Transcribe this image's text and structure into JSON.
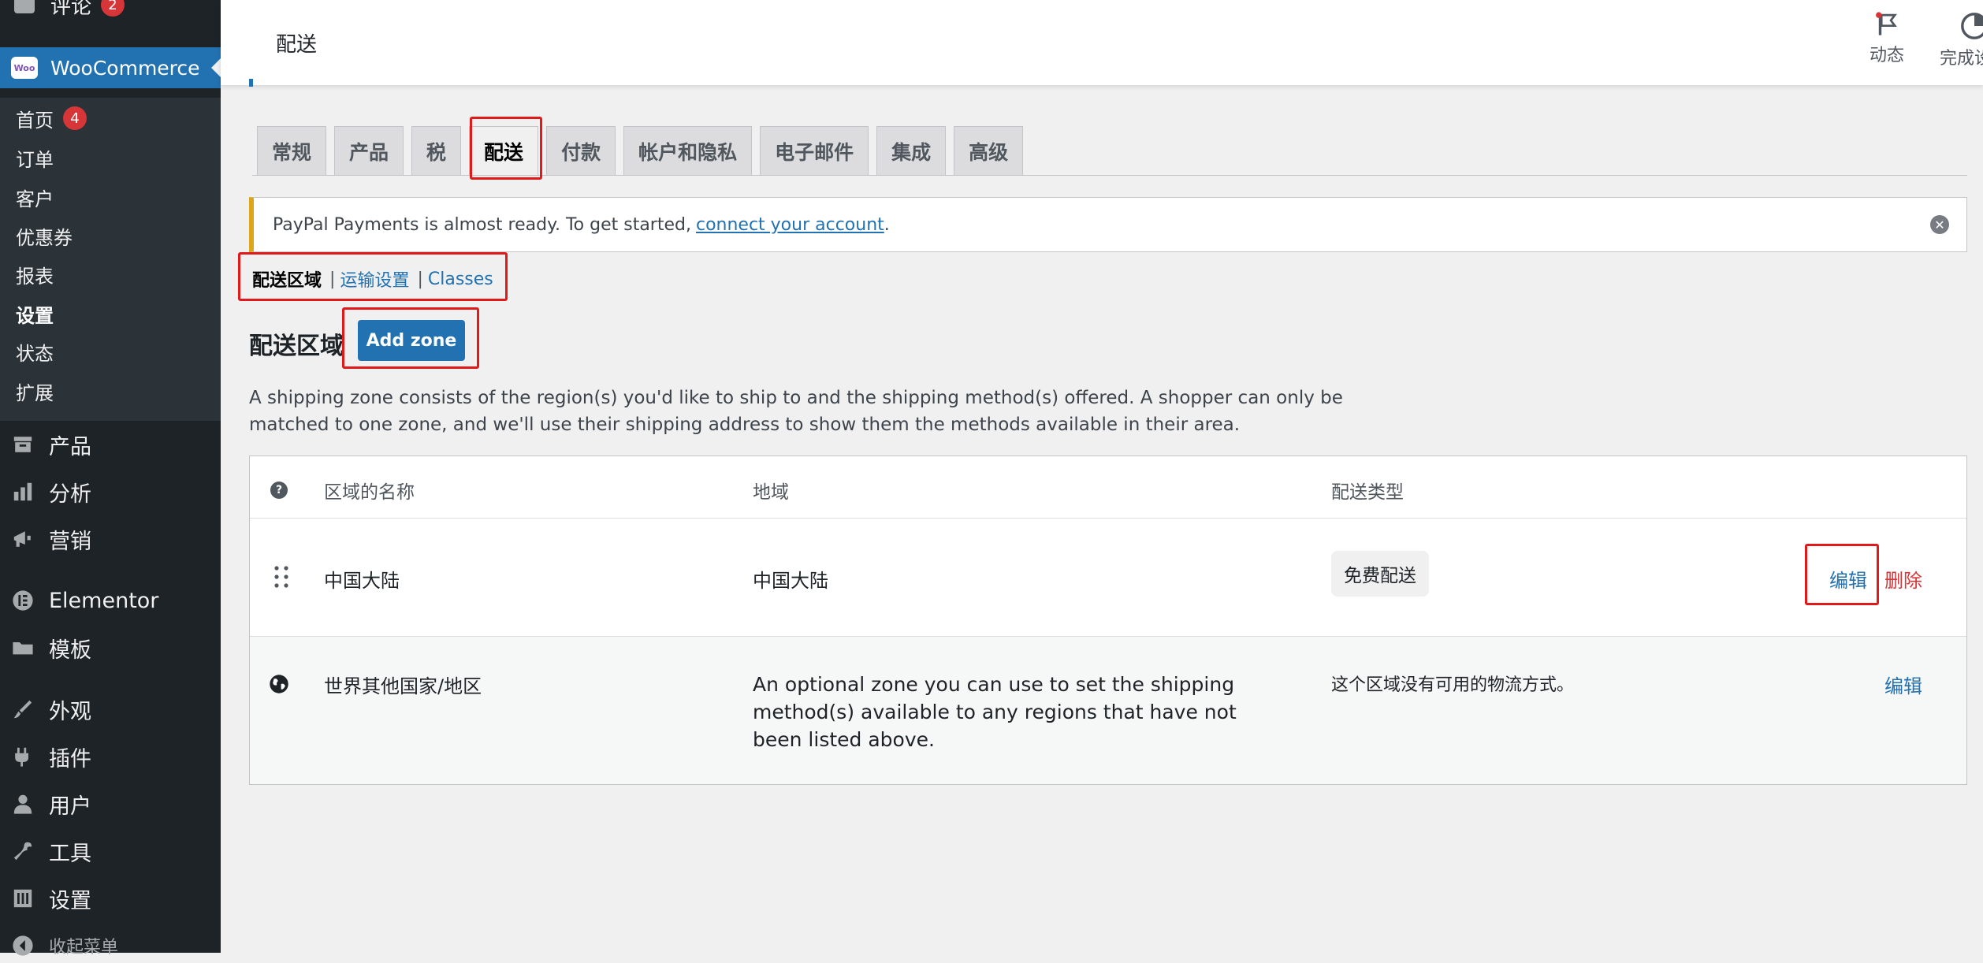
{
  "sidebar": {
    "top_partial": {
      "label": "评论",
      "badge": "2"
    },
    "woocommerce": {
      "label": "WooCommerce",
      "icon_text": "Woo"
    },
    "submenu": [
      {
        "label": "首页",
        "badge": "4"
      },
      {
        "label": "订单"
      },
      {
        "label": "客户"
      },
      {
        "label": "优惠券"
      },
      {
        "label": "报表"
      },
      {
        "label": "设置",
        "active": true
      },
      {
        "label": "状态"
      },
      {
        "label": "扩展"
      }
    ],
    "menu": [
      {
        "label": "产品",
        "icon": "archive-icon"
      },
      {
        "label": "分析",
        "icon": "bar-chart-icon"
      },
      {
        "label": "营销",
        "icon": "megaphone-icon"
      },
      {
        "label": "Elementor",
        "icon": "elementor-icon"
      },
      {
        "label": "模板",
        "icon": "folder-icon"
      },
      {
        "label": "外观",
        "icon": "brush-icon"
      },
      {
        "label": "插件",
        "icon": "plug-icon"
      },
      {
        "label": "用户",
        "icon": "user-icon"
      },
      {
        "label": "工具",
        "icon": "wrench-icon"
      },
      {
        "label": "设置",
        "icon": "settings-icon"
      },
      {
        "label": "收起菜单",
        "icon": "collapse-icon"
      }
    ]
  },
  "header": {
    "title": "配送",
    "actions": [
      {
        "label": "动态",
        "icon": "flag-icon"
      },
      {
        "label": "完成设置",
        "icon": "progress-icon"
      }
    ]
  },
  "tabs": [
    {
      "label": "常规"
    },
    {
      "label": "产品"
    },
    {
      "label": "税"
    },
    {
      "label": "配送",
      "active": true
    },
    {
      "label": "付款"
    },
    {
      "label": "帐户和隐私"
    },
    {
      "label": "电子邮件"
    },
    {
      "label": "集成"
    },
    {
      "label": "高级"
    }
  ],
  "notice": {
    "text": "PayPal Payments is almost ready. To get started,",
    "link": "connect your account",
    "end": "."
  },
  "subnav": {
    "current": "配送区域",
    "links": [
      "运输设置",
      "Classes"
    ],
    "separator": "|"
  },
  "zones": {
    "heading": "配送区域",
    "add_button": "Add zone",
    "description": "A shipping zone consists of the region(s) you'd like to ship to and the shipping method(s) offered. A shopper can only be matched to one zone, and we'll use their shipping address to show them the methods available in their area.",
    "columns": {
      "name": "区域的名称",
      "region": "地域",
      "methods": "配送类型"
    },
    "rows": [
      {
        "name": "中国大陆",
        "region": "中国大陆",
        "method": "免费配送",
        "edit": "编辑",
        "delete": "删除"
      },
      {
        "name": "世界其他国家/地区",
        "region": "An optional zone you can use to set the shipping method(s) available to any regions that have not been listed above.",
        "method": "这个区域没有可用的物流方式。",
        "edit": "编辑"
      }
    ]
  },
  "colors": {
    "sidebar_bg": "#1d2327",
    "submenu_bg": "#2c3338",
    "accent": "#2271b1",
    "notice_border": "#dba617",
    "delete": "#d63638",
    "highlight": "#e0191b"
  }
}
